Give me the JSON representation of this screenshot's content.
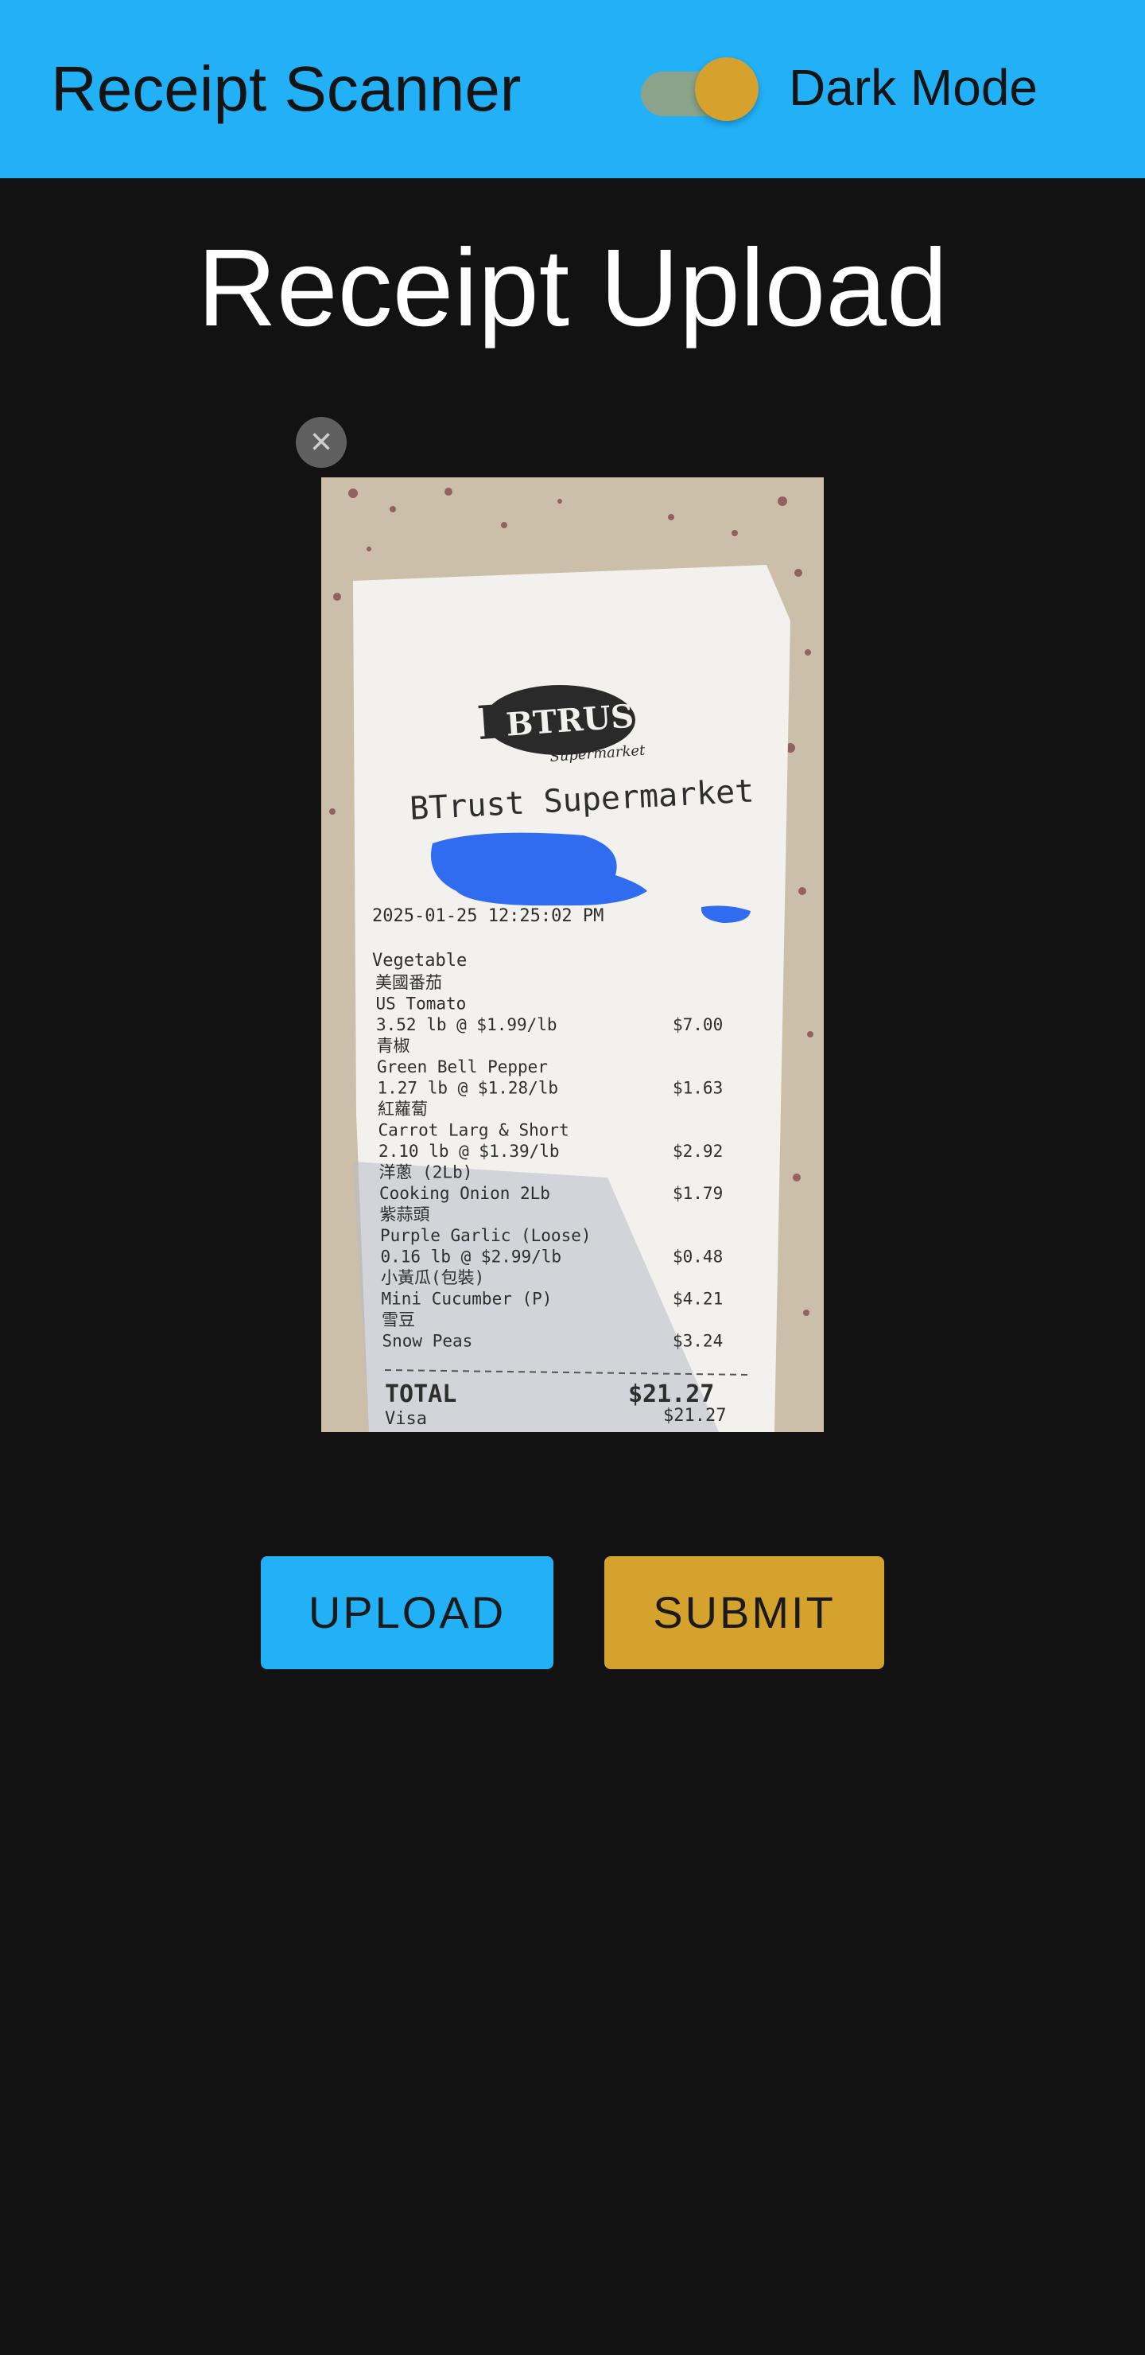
{
  "app_bar": {
    "title": "Receipt Scanner",
    "dark_mode_label": "Dark Mode",
    "dark_mode_on": true,
    "toggle_thumb_color": "#d6a22e",
    "bar_color": "#22b0f7"
  },
  "main": {
    "title": "Receipt Upload",
    "remove_icon": "×"
  },
  "receipt": {
    "logo": "BTRUST",
    "logo_sub": "Supermarket",
    "store": "BTrust Supermarket",
    "datetime": "2025-01-25 12:25:02 PM",
    "category": "Vegetable",
    "lines": [
      {
        "text": "美國番茄",
        "price": ""
      },
      {
        "text": "US Tomato",
        "price": ""
      },
      {
        "text": " 3.52 lb @ $1.99/lb",
        "price": "$7.00"
      },
      {
        "text": "青椒",
        "price": ""
      },
      {
        "text": "Green Bell Pepper",
        "price": ""
      },
      {
        "text": " 1.27 lb @ $1.28/lb",
        "price": "$1.63"
      },
      {
        "text": "紅蘿蔔",
        "price": ""
      },
      {
        "text": "Carrot Larg & Short",
        "price": ""
      },
      {
        "text": " 2.10 lb @ $1.39/lb",
        "price": "$2.92"
      },
      {
        "text": "洋蔥 (2Lb)",
        "price": ""
      },
      {
        "text": "Cooking Onion 2Lb",
        "price": "$1.79"
      },
      {
        "text": "紫蒜頭",
        "price": ""
      },
      {
        "text": "Purple Garlic (Loose)",
        "price": ""
      },
      {
        "text": " 0.16 lb @ $2.99/lb",
        "price": "$0.48"
      },
      {
        "text": "小黃瓜(包裝)",
        "price": ""
      },
      {
        "text": "Mini Cucumber (P)",
        "price": "$4.21"
      },
      {
        "text": "雪豆",
        "price": ""
      },
      {
        "text": "Snow Peas",
        "price": "$3.24"
      }
    ],
    "total_label": "TOTAL",
    "total": "$21.27",
    "payment_label": "Visa",
    "payment": "$21.27"
  },
  "actions": {
    "upload_label": "UPLOAD",
    "submit_label": "SUBMIT"
  }
}
